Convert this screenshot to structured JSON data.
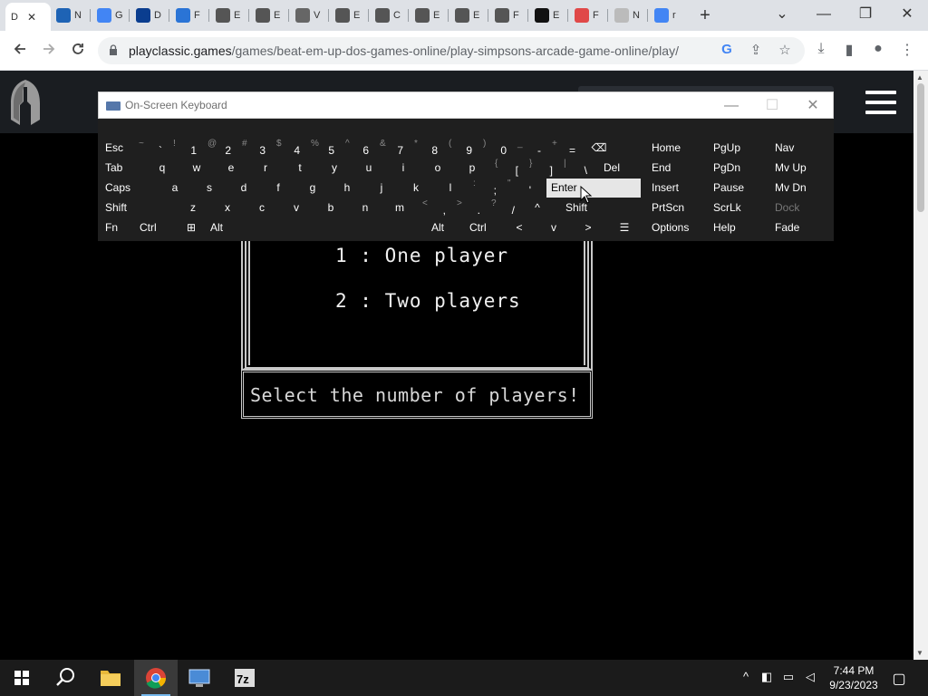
{
  "browser": {
    "active_tab": {
      "title": "D",
      "close": "✕"
    },
    "tabs": [
      {
        "title": "N",
        "color": "#1e63b5"
      },
      {
        "title": "G",
        "color": "#4285f4"
      },
      {
        "title": "D",
        "color": "#0a3d8f"
      },
      {
        "title": "F",
        "color": "#2a74d6"
      },
      {
        "title": "E",
        "color": "#555555"
      },
      {
        "title": "E",
        "color": "#555555"
      },
      {
        "title": "V",
        "color": "#666666"
      },
      {
        "title": "E",
        "color": "#555555"
      },
      {
        "title": "C",
        "color": "#555555"
      },
      {
        "title": "E",
        "color": "#555555"
      },
      {
        "title": "E",
        "color": "#555555"
      },
      {
        "title": "F",
        "color": "#555555"
      },
      {
        "title": "E",
        "color": "#111111"
      },
      {
        "title": "F",
        "color": "#e04848"
      },
      {
        "title": "N",
        "color": "#bbbbbb"
      },
      {
        "title": "r",
        "color": "#4285f4"
      }
    ],
    "new_tab": "+",
    "window_controls": {
      "tab_search": "⌄",
      "minimize": "—",
      "maximize": "❐",
      "close": "✕"
    },
    "url_host": "playclassic.games",
    "url_path": "/games/beat-em-up-dos-games-online/play-simpsons-arcade-game-online/play/"
  },
  "game": {
    "option1": "1 : One player",
    "option2": "2 : Two players",
    "prompt": "Select the number of players!"
  },
  "osk": {
    "title": "On-Screen Keyboard",
    "rows": [
      [
        {
          "main": "Esc"
        },
        {
          "sub": "~",
          "primary": "`"
        },
        {
          "sub": "!",
          "primary": "1"
        },
        {
          "sub": "@",
          "primary": "2"
        },
        {
          "sub": "#",
          "primary": "3"
        },
        {
          "sub": "$",
          "primary": "4"
        },
        {
          "sub": "%",
          "primary": "5"
        },
        {
          "sub": "^",
          "primary": "6"
        },
        {
          "sub": "&",
          "primary": "7"
        },
        {
          "sub": "*",
          "primary": "8"
        },
        {
          "sub": "(",
          "primary": "9"
        },
        {
          "sub": ")",
          "primary": "0"
        },
        {
          "sub": "_",
          "primary": "-"
        },
        {
          "sub": "+",
          "primary": "="
        },
        {
          "center": "⌫"
        }
      ],
      [
        {
          "main": "Tab"
        },
        {
          "center": "q"
        },
        {
          "center": "w"
        },
        {
          "center": "e"
        },
        {
          "center": "r"
        },
        {
          "center": "t"
        },
        {
          "center": "y"
        },
        {
          "center": "u"
        },
        {
          "center": "i"
        },
        {
          "center": "o"
        },
        {
          "center": "p"
        },
        {
          "sub": "{",
          "primary": "["
        },
        {
          "sub": "}",
          "primary": "]"
        },
        {
          "sub": "|",
          "primary": "\\"
        },
        {
          "main": "Del"
        }
      ],
      [
        {
          "main": "Caps"
        },
        {
          "center": "a"
        },
        {
          "center": "s"
        },
        {
          "center": "d"
        },
        {
          "center": "f"
        },
        {
          "center": "g"
        },
        {
          "center": "h"
        },
        {
          "center": "j"
        },
        {
          "center": "k"
        },
        {
          "center": "l"
        },
        {
          "sub": ":",
          "primary": ";"
        },
        {
          "sub": "\"",
          "primary": "'"
        },
        {
          "main": "Enter",
          "hl": true
        }
      ],
      [
        {
          "main": "Shift"
        },
        {
          "center": "z"
        },
        {
          "center": "x"
        },
        {
          "center": "c"
        },
        {
          "center": "v"
        },
        {
          "center": "b"
        },
        {
          "center": "n"
        },
        {
          "center": "m"
        },
        {
          "sub": "<",
          "primary": ","
        },
        {
          "sub": ">",
          "primary": "."
        },
        {
          "sub": "?",
          "primary": "/"
        },
        {
          "center": "^"
        },
        {
          "main": "Shift"
        }
      ],
      [
        {
          "main": "Fn"
        },
        {
          "main": "Ctrl"
        },
        {
          "center": "⊞"
        },
        {
          "main": "Alt"
        },
        {
          "main": ""
        },
        {
          "main": "Alt"
        },
        {
          "main": "Ctrl"
        },
        {
          "center": "<"
        },
        {
          "center": "v"
        },
        {
          "center": ">"
        },
        {
          "center": "☰"
        }
      ]
    ],
    "nav": [
      [
        "Home",
        "PgUp",
        "Nav"
      ],
      [
        "End",
        "PgDn",
        "Mv Up"
      ],
      [
        "Insert",
        "Pause",
        "Mv Dn"
      ],
      [
        "PrtScn",
        "ScrLk",
        "Dock"
      ],
      [
        "Options",
        "Help",
        "Fade"
      ]
    ]
  },
  "taskbar": {
    "time": "7:44 PM",
    "date": "9/23/2023"
  }
}
